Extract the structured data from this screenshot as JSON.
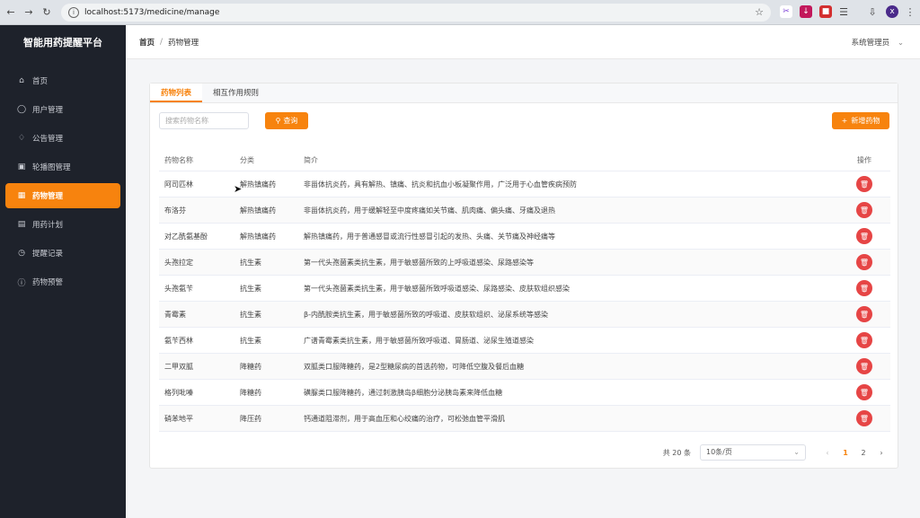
{
  "browser": {
    "url": "localhost:5173/medicine/manage"
  },
  "sidebar": {
    "brand": "智能用药提醒平台",
    "items": [
      {
        "label": "首页",
        "icon": "home-icon"
      },
      {
        "label": "用户管理",
        "icon": "user-icon"
      },
      {
        "label": "公告管理",
        "icon": "bell-icon"
      },
      {
        "label": "轮播图管理",
        "icon": "image-icon"
      },
      {
        "label": "药物管理",
        "icon": "medicine-icon",
        "active": true
      },
      {
        "label": "用药计划",
        "icon": "calendar-icon"
      },
      {
        "label": "提醒记录",
        "icon": "clock-icon"
      },
      {
        "label": "药物预警",
        "icon": "warning-icon"
      }
    ]
  },
  "header": {
    "breadcrumb_home": "首页",
    "breadcrumb_current": "药物管理",
    "user": "系统管理员"
  },
  "tabs": [
    "药物列表",
    "相互作用规则"
  ],
  "toolbar": {
    "search_placeholder": "搜索药物名称",
    "query_label": "查询",
    "add_label": "新增药物"
  },
  "table": {
    "columns": [
      "药物名称",
      "分类",
      "简介",
      "操作"
    ],
    "rows": [
      {
        "name": "阿司匹林",
        "category": "解热镇痛药",
        "desc": "非甾体抗炎药，具有解热、镇痛、抗炎和抗血小板凝聚作用，广泛用于心血管疾病预防"
      },
      {
        "name": "布洛芬",
        "category": "解热镇痛药",
        "desc": "非甾体抗炎药，用于缓解轻至中度疼痛如关节痛、肌肉痛、偏头痛、牙痛及退热"
      },
      {
        "name": "对乙酰氨基酚",
        "category": "解热镇痛药",
        "desc": "解热镇痛药，用于普通感冒或流行性感冒引起的发热、头痛、关节痛及神经痛等"
      },
      {
        "name": "头孢拉定",
        "category": "抗生素",
        "desc": "第一代头孢菌素类抗生素，用于敏感菌所致的上呼吸道感染、尿路感染等"
      },
      {
        "name": "头孢氨苄",
        "category": "抗生素",
        "desc": "第一代头孢菌素类抗生素，用于敏感菌所致呼吸道感染、尿路感染、皮肤软组织感染"
      },
      {
        "name": "青霉素",
        "category": "抗生素",
        "desc": "β-内酰胺类抗生素，用于敏感菌所致的呼吸道、皮肤软组织、泌尿系统等感染"
      },
      {
        "name": "氨苄西林",
        "category": "抗生素",
        "desc": "广谱青霉素类抗生素，用于敏感菌所致呼吸道、胃肠道、泌尿生殖道感染"
      },
      {
        "name": "二甲双胍",
        "category": "降糖药",
        "desc": "双胍类口服降糖药，是2型糖尿病的首选药物，可降低空腹及餐后血糖"
      },
      {
        "name": "格列吡嗪",
        "category": "降糖药",
        "desc": "磺脲类口服降糖药，通过刺激胰岛β细胞分泌胰岛素来降低血糖"
      },
      {
        "name": "硝苯地平",
        "category": "降压药",
        "desc": "钙通道阻滞剂，用于高血压和心绞痛的治疗，可松弛血管平滑肌"
      }
    ]
  },
  "pagination": {
    "total": "共 20 条",
    "page_size": "10条/页",
    "pages": [
      "1",
      "2"
    ],
    "current": "1"
  },
  "colors": {
    "accent": "#f7830e",
    "danger": "#e64545",
    "sidebar_bg": "#1e222b"
  }
}
